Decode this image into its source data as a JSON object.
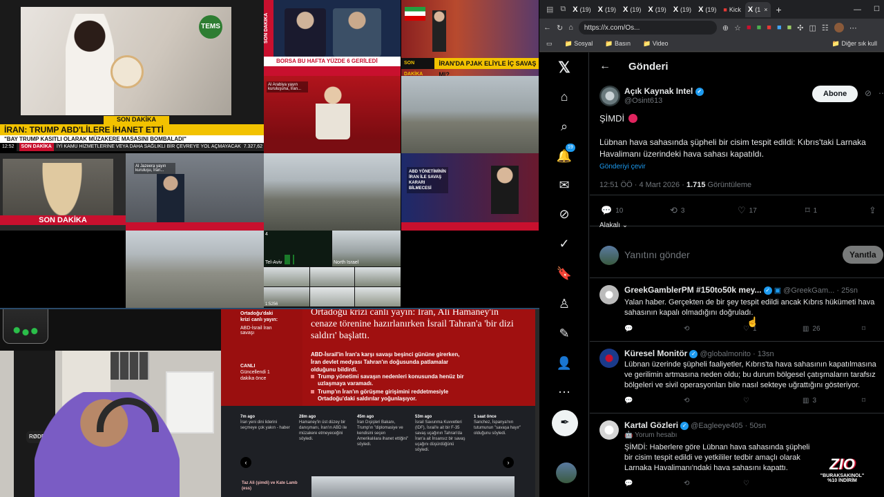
{
  "stream": {
    "tile1_channel": "TEMS",
    "tile1_tag": "SON DAKİKA",
    "tile1_headline": "İRAN: TRUMP ABD'LİLERE İHANET ETTİ",
    "tile1_sub": "\"BAY TRUMP KASITLI OLARAK MÜZAKERE MASASINI BOMBALADI\"",
    "tile1_tag2": "SON DAKİKA",
    "tile1_ticker": "İYİ KAMU HİZMETLERİNE VEYA DAHA SAĞLIKLI BİR ÇEVREYE YOL AÇMAYACAK",
    "tile1_time": "12:52",
    "tile1_index": "7.327,62",
    "tile2_tag": "SON DAKİKA",
    "tile2_ticker": "BORSA BU HAFTA YÜZDE 6 GERİLEDİ",
    "tile3_ticker": "İRAN'DA PJAK ELİYLE İÇ SAVAŞ MI?",
    "tile3_tag": "SON DAKİKA",
    "tile4_tag": "SON DAKİKA",
    "tile4_channel": "Al Arabiya yayın kuruluşuna, İran...",
    "tile5_channel": "Al Jazeera yayın kuruluşu, İran...",
    "tile6_tag": "ABD YÖNETİMİNİN İRAN İLE SAVAŞ KARARI BİLMECESİ",
    "tile7_cam1": "Tel-Aviv",
    "tile7_cam2": "North Israel",
    "tile7_num": "4",
    "tile7_time": "1:5256"
  },
  "article": {
    "kicker": "Ortadoğu'daki krizi canlı yayın:",
    "side_label": "ABD-İsrail İran savaşı",
    "title": "Ortadoğu krizi canlı yayın: İran, Ali Hamaney'in cenaze törenine hazırlanırken İsrail Tahran'a 'bir dizi saldırı' başlattı.",
    "live": "CANLI",
    "updated": "Güncellendi 1 dakika önce",
    "summary": "ABD-İsrail'in İran'a karşı savaşı beşinci gününe girerken, İran devlet medyası Tahran'ın doğusunda patlamalar olduğunu bildirdi.",
    "bullet1": "Trump yönetimi savaşın nedenleri konusunda henüz bir uzlaşmaya varamadı.",
    "bullet2": "Trump'ın İran'ın görüşme girişimini reddetmesiyle Ortadoğu'daki saldırılar yoğunlaşıyor.",
    "timeline": [
      {
        "time": "7m ago",
        "text": "İran yeni dini liderini seçmeye çok yakın - haber"
      },
      {
        "time": "28m ago",
        "text": "Hamaney'in üst düzey bir danışmanı, İran'ın ABD ile müzakere etmeyeceğini söyledi."
      },
      {
        "time": "45m ago",
        "text": "İran Dışişleri Bakanı, Trump'ın \"diplomasiye ve kendisini seçen Amerikalılara ihanet ettiğini\" söyledi."
      },
      {
        "time": "53m ago",
        "text": "İsrail Savunma Kuvvetleri (IDF), İsrail'e ait bir F-35 savaş uçağının Tahran'da İran'a ait İnsansız bir savaş uçağını düşürdüğünü söyledi."
      },
      {
        "time": "1 saat önce",
        "text": "Sanchez, İspanya'nın tutumunun \"savaşa hayır\" olduğunu söyledi."
      }
    ],
    "author": "Taz Ali (şimdi) ve Kate Lamb (ess)"
  },
  "browser": {
    "tabs": [
      "(19)",
      "(19)",
      "(19)",
      "(19)",
      "(19)",
      "(19)",
      "Kick",
      "(1"
    ],
    "url": "https://x.com/Os...",
    "bookmarks": [
      "Sosyal",
      "Basın",
      "Video",
      "Diğer sık kull"
    ]
  },
  "x": {
    "header_title": "Gönderi",
    "notif_count": "19",
    "author_name": "Açık Kaynak Intel",
    "author_handle": "@Osint613",
    "follow_label": "Abone",
    "post_line1": "ŞİMDİ",
    "post_body": "Lübnan hava sahasında şüpheli bir cisim tespit edildi: Kıbrıs'taki Larnaka Havalimanı üzerindeki hava sahası kapatıldı.",
    "translate": "Gönderiyi çevir",
    "meta_time": "12:51 ÖÖ · 4 Mart 2026 ·",
    "meta_views": "1.715",
    "meta_views_label": "Görüntüleme",
    "replies": "10",
    "reposts": "3",
    "likes": "17",
    "bookmarks": "1",
    "relevance": "Alakalı",
    "reply_placeholder": "Yanıtını gönder",
    "reply_button": "Yanıtla",
    "comments": [
      {
        "name": "GreekGamblerPM #150to50k mey...",
        "handle": "@GreekGam...",
        "time": "25sn",
        "text": "Yalan haber. Gerçekten de bir şey tespit edildi ancak Kıbrıs hükümeti hava sahasının kapalı olmadığını doğruladı.",
        "likes": "1",
        "views": "26"
      },
      {
        "name": "Küresel Monitör",
        "handle": "@globalmonito",
        "time": "13sn",
        "text": "Lübnan üzerinde şüpheli faaliyetler, Kıbrıs'ta hava sahasının kapatılmasına ve gerilimin artmasına neden oldu; bu durum bölgesel çatışmaların tarafsız bölgeleri ve sivil operasyonları bile nasıl sekteye uğrattığını gösteriyor.",
        "likes": "",
        "views": "3"
      },
      {
        "name": "Kartal Gözleri",
        "handle": "@Eagleeye405",
        "time": "50sn",
        "sub": "Yorum hesabı",
        "text": "ŞİMDİ: Haberlere göre Lübnan hava sahasında şüpheli bir cisim tespit edildi ve yetkililer tedbir amaçlı olarak Larnaka Havalimanı'ndaki hava sahasını kapattı.",
        "likes": "",
        "views": ""
      }
    ]
  },
  "overlay": {
    "brand": "ZIO",
    "promo1": "\"BURAKSAKINOL\"",
    "promo2": "%10 İNDİRİM",
    "mic": "RØDE"
  },
  "colors": {
    "x_blue": "#1d9bf0",
    "news_red": "#c8102e",
    "article_red": "#8b0d0d"
  }
}
